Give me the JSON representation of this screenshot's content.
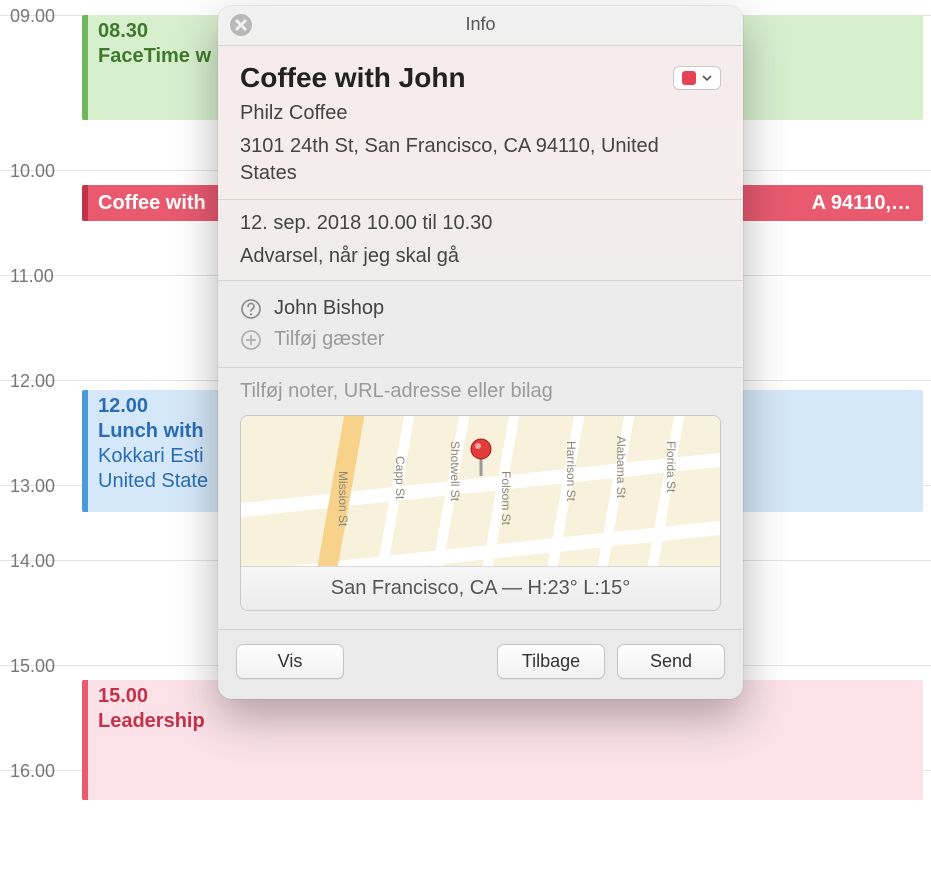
{
  "calendar": {
    "hours": [
      "09.00",
      "10.00",
      "11.00",
      "12.00",
      "13.00",
      "14.00",
      "15.00",
      "16.00"
    ],
    "events": {
      "facetime": {
        "time": "08.30",
        "title": "FaceTime w"
      },
      "coffee": {
        "title": "Coffee with",
        "address_tail": "A  94110,…"
      },
      "lunch": {
        "time": "12.00",
        "title": "Lunch with",
        "line2": "Kokkari Esti",
        "line3": "United State"
      },
      "leadership": {
        "time": "15.00",
        "title": "Leadership"
      }
    }
  },
  "popover": {
    "header": "Info",
    "event_title": "Coffee with John",
    "location_name": "Philz Coffee",
    "location_address": "3101 24th St, San Francisco, CA  94110, United States",
    "datetime": "12. sep. 2018  10.00 til 10.30",
    "alert": "Advarsel, når jeg skal gå",
    "guest": "John Bishop",
    "add_guests": "Tilføj gæster",
    "notes_placeholder": "Tilføj noter, URL-adresse eller bilag",
    "map": {
      "streets": [
        "Mission St",
        "Capp St",
        "Shotwell St",
        "Folsom St",
        "Harrison St",
        "Alabama St",
        "Florida St"
      ],
      "caption": "San Francisco, CA — H:23° L:15°"
    },
    "buttons": {
      "show": "Vis",
      "back": "Tilbage",
      "send": "Send"
    },
    "calendar_color": "#e64256"
  }
}
